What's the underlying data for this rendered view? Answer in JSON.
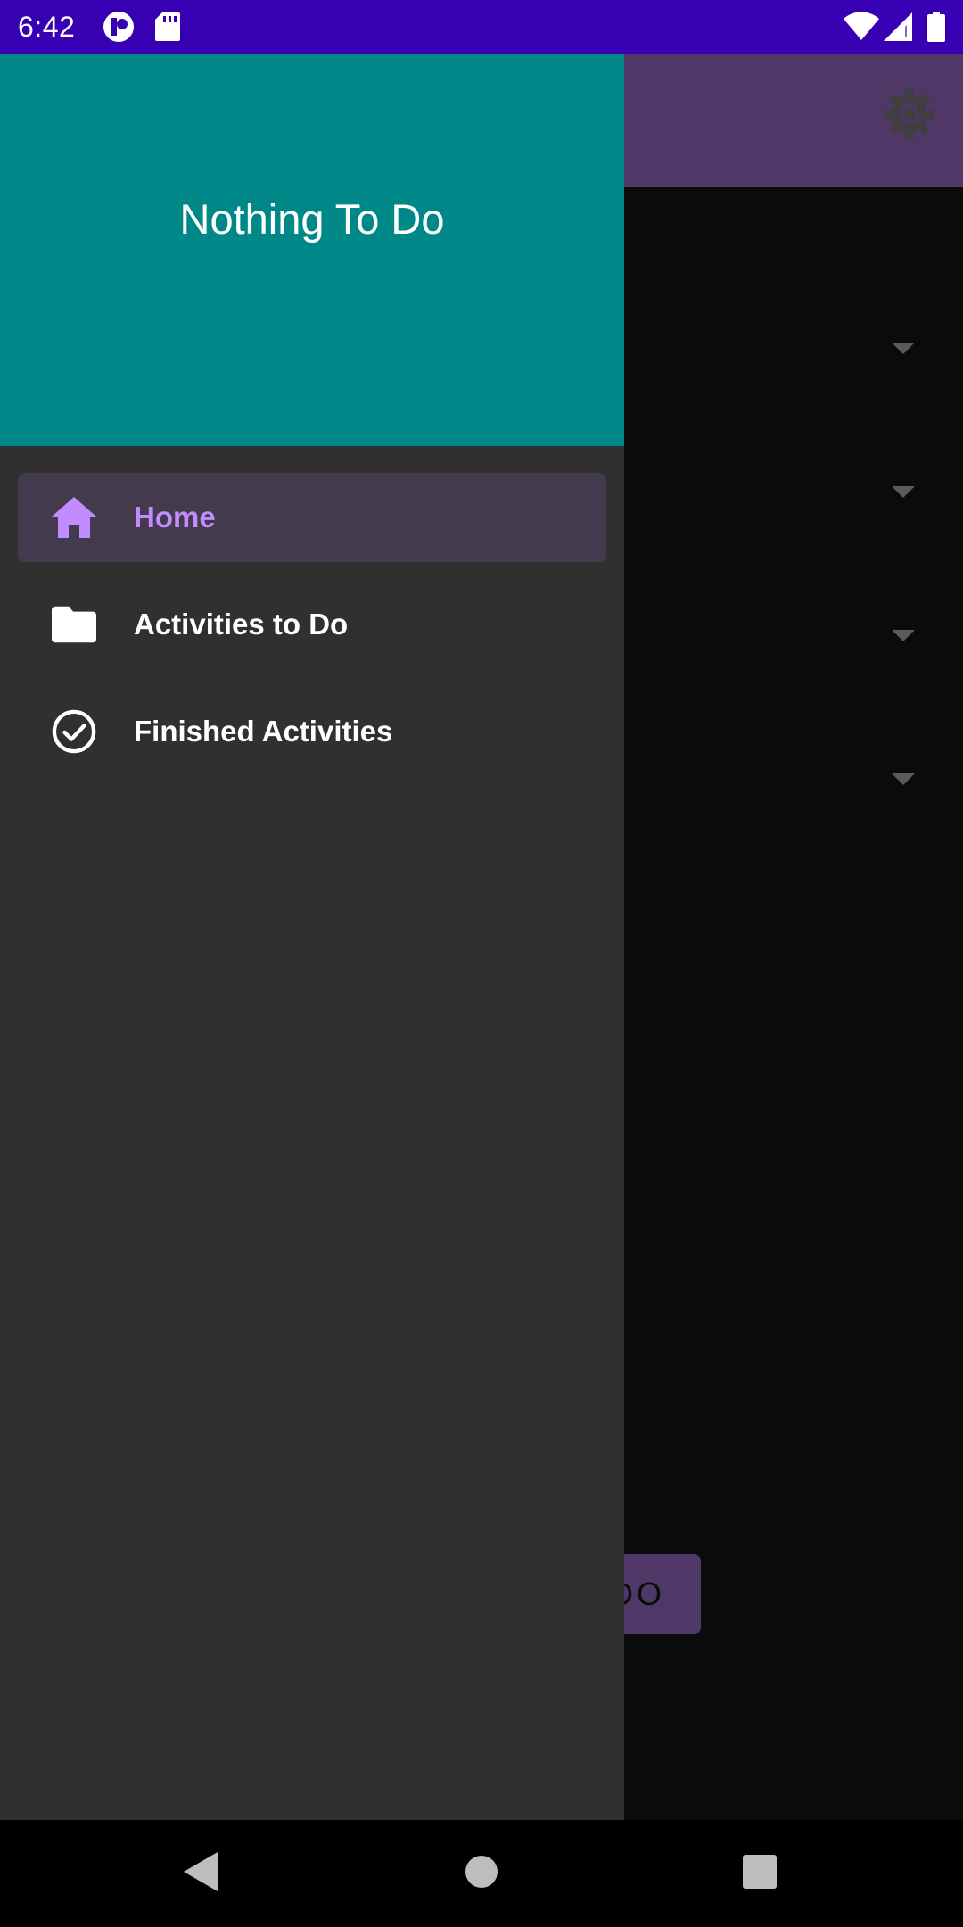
{
  "status_bar": {
    "time": "6:42",
    "icons": [
      "app-notification-icon",
      "sd-card-icon",
      "wifi-icon",
      "signal-icon",
      "battery-icon"
    ]
  },
  "app": {
    "toolbar_color": "#4f3868",
    "settings_icon": "gear-icon",
    "dropdown_count": 4,
    "button_partial_label": "DO"
  },
  "drawer": {
    "header_color": "#008888",
    "title": "Nothing To Do",
    "items": [
      {
        "label": "Home",
        "icon": "home-icon",
        "selected": true
      },
      {
        "label": "Activities to Do",
        "icon": "folder-icon",
        "selected": false
      },
      {
        "label": "Finished Activities",
        "icon": "check-circle-icon",
        "selected": false
      }
    ],
    "accent_color": "#c28cff"
  },
  "nav_bar": {
    "buttons": [
      "back-icon",
      "home-circle-icon",
      "recents-icon"
    ]
  }
}
